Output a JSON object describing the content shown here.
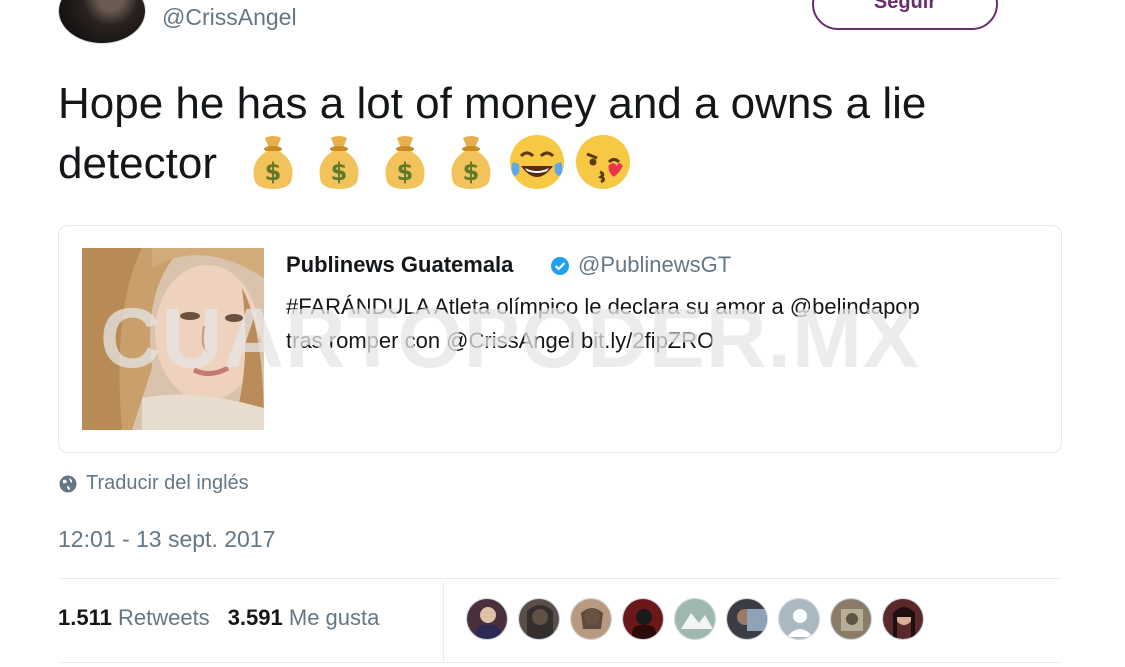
{
  "header": {
    "handle": "@CrissAngel",
    "follow_label": "Seguir"
  },
  "tweet": {
    "text_line1": "Hope he has a lot of money and a owns a lie",
    "text_line2": "detector",
    "emojis": [
      "money-bag-emoji",
      "money-bag-emoji",
      "money-bag-emoji",
      "money-bag-emoji",
      "tears-of-joy-emoji",
      "kissing-face-emoji"
    ]
  },
  "quote": {
    "name": "Publinews Guatemala",
    "handle": "@PublinewsGT",
    "text_line1": "#FARÁNDULA Atleta olímpico le declara su amor a @belindapop",
    "text_line2": "tras romper con @CrissAngel bit.ly/2fipZRO"
  },
  "watermark": "CUARTOPODER.MX",
  "translate_label": "Traducir del inglés",
  "timestamp": "12:01 - 13 sept. 2017",
  "stats": {
    "retweets_count": "1.511",
    "retweets_label": "Retweets",
    "likes_count": "3.591",
    "likes_label": "Me gusta"
  },
  "likers": [
    {
      "color": "#4a2f3c"
    },
    {
      "color": "#5b4e4a"
    },
    {
      "color": "#b89a80"
    },
    {
      "color": "#6b1818"
    },
    {
      "color": "#9fb8ad"
    },
    {
      "color": "#3c3c44"
    },
    {
      "color": "#aab8c2"
    },
    {
      "color": "#8a7c66"
    },
    {
      "color": "#5a2a2a"
    }
  ]
}
